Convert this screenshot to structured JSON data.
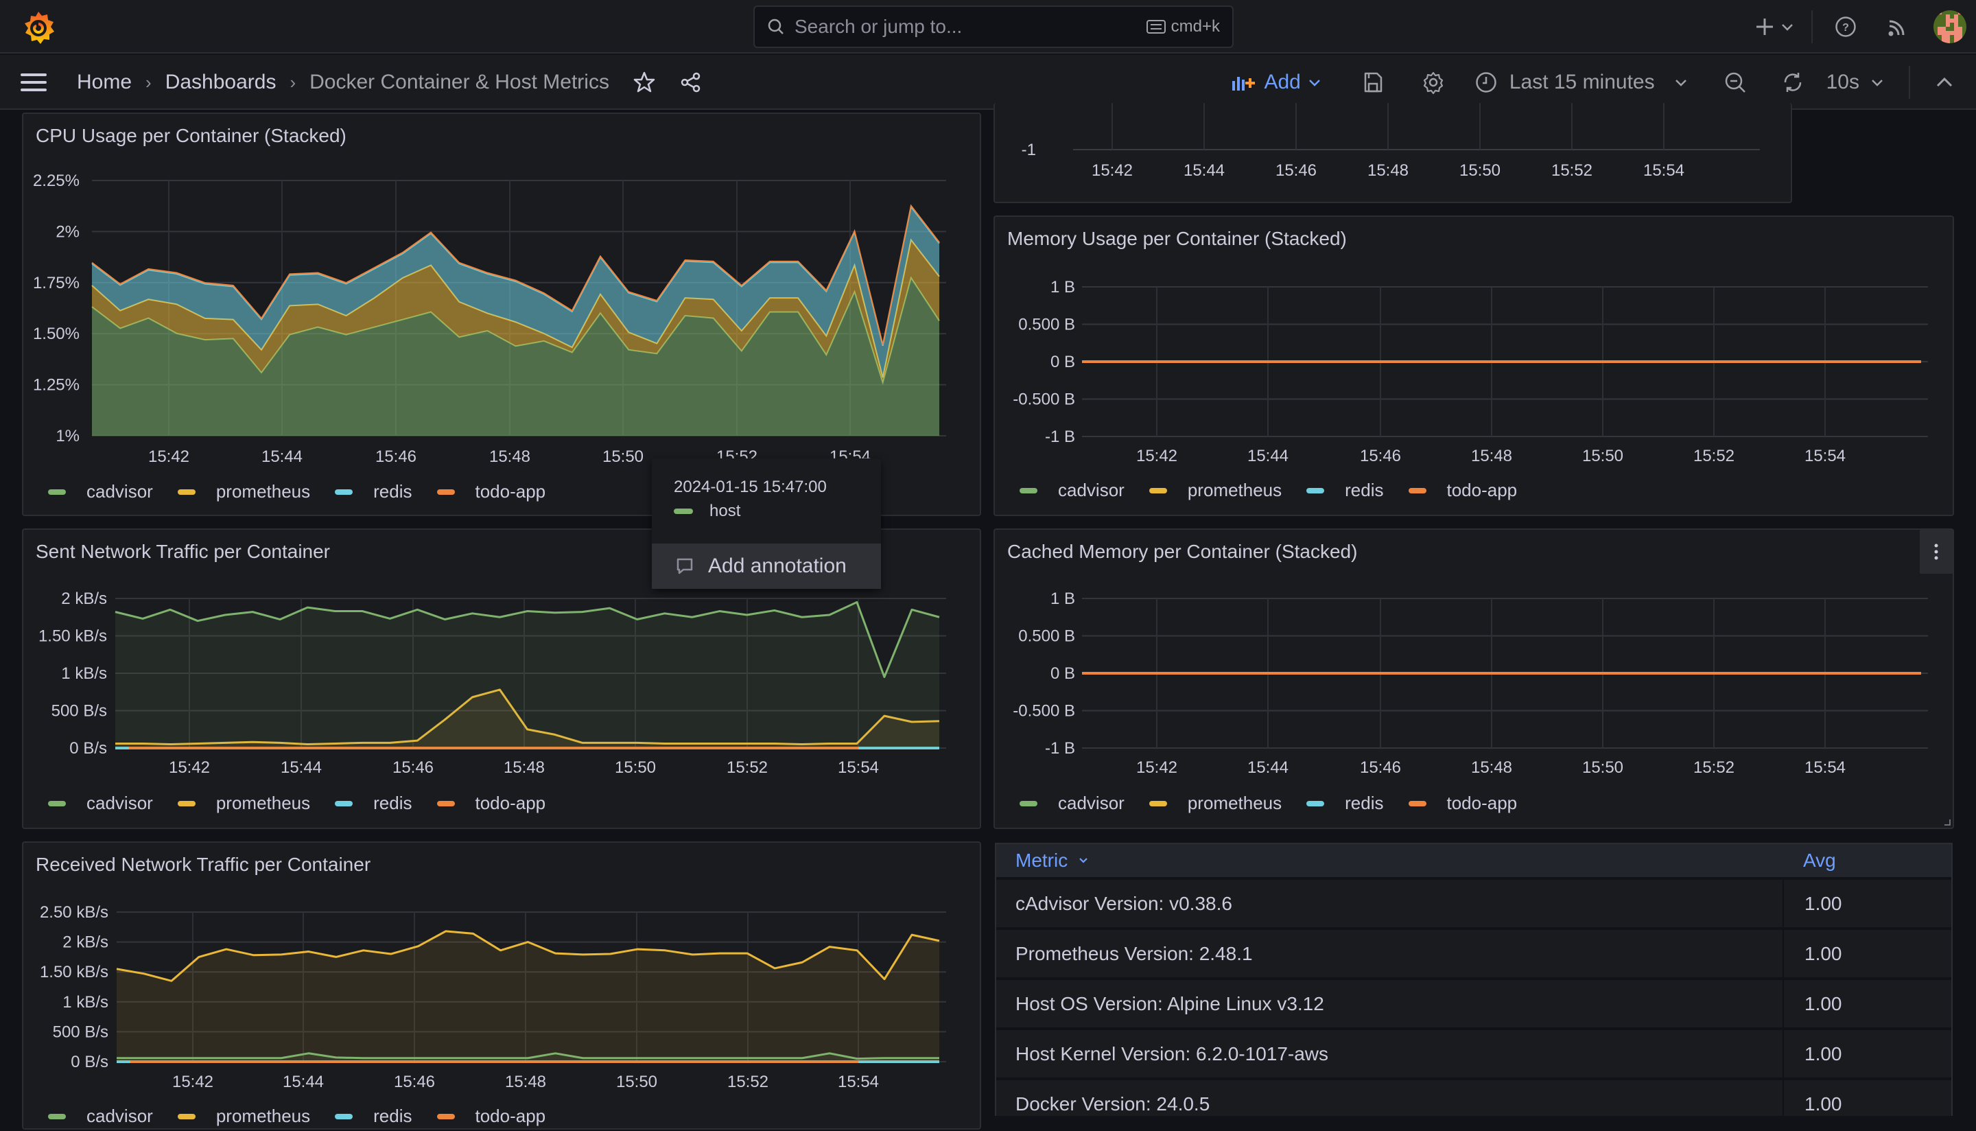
{
  "topbar": {
    "search_placeholder": "Search or jump to...",
    "shortcut": "cmd+k",
    "icons": [
      "grafana-logo",
      "search-icon",
      "keyboard-icon",
      "plus-icon",
      "chevron-down-icon",
      "help-icon",
      "news-icon",
      "avatar"
    ]
  },
  "navbar": {
    "breadcrumbs": [
      "Home",
      "Dashboards",
      "Docker Container & Host Metrics"
    ],
    "add_label": "Add",
    "time_range": "Last 15 minutes",
    "refresh_interval": "10s",
    "accent": "#6e9fff"
  },
  "series_colors": {
    "cadvisor": "#7eb26d",
    "prometheus": "#eab839",
    "redis": "#6ed0e0",
    "todo-app": "#ef843c",
    "host": "#7eb26d"
  },
  "legend": [
    "cadvisor",
    "prometheus",
    "redis",
    "todo-app"
  ],
  "tooltip": {
    "timestamp": "2024-01-15 15:47:00",
    "series": "host",
    "action": "Add annotation"
  },
  "table": {
    "headers": [
      "Metric",
      "Avg"
    ],
    "rows": [
      [
        "cAdvisor Version: v0.38.6",
        "1.00"
      ],
      [
        "Prometheus Version: 2.48.1",
        "1.00"
      ],
      [
        "Host OS Version: Alpine Linux v3.12",
        "1.00"
      ],
      [
        "Host Kernel Version: 6.2.0-1017-aws",
        "1.00"
      ],
      [
        "Docker Version: 24.0.5",
        "1.00"
      ]
    ]
  },
  "chart_data": [
    {
      "id": "cpu",
      "type": "area",
      "stacked": true,
      "title": "CPU Usage per Container (Stacked)",
      "x_ticks": [
        "15:42",
        "15:44",
        "15:46",
        "15:48",
        "15:50",
        "15:52",
        "15:54"
      ],
      "x_range_min": [
        0,
        15.25
      ],
      "x_tick_positions_min": [
        1.35,
        3.35,
        5.35,
        7.35,
        9.35,
        11.35,
        13.35
      ],
      "y_ticks": [
        "1%",
        "1.25%",
        "1.50%",
        "1.75%",
        "2%",
        "2.25%"
      ],
      "ylim": [
        1,
        2.25
      ],
      "y_unit": "%",
      "legend": "bottom-left",
      "series": [
        {
          "name": "cadvisor",
          "values": [
            1.631,
            1.526,
            1.576,
            1.501,
            1.47,
            1.476,
            1.309,
            1.495,
            1.532,
            1.495,
            1.532,
            1.569,
            1.606,
            1.483,
            1.514,
            1.439,
            1.464,
            1.408,
            1.6,
            1.421,
            1.402,
            1.588,
            1.576,
            1.415,
            1.606,
            1.606,
            1.396,
            1.705,
            1.26,
            1.773,
            1.563
          ]
        },
        {
          "name": "prometheus",
          "values": [
            0.105,
            0.087,
            0.092,
            0.143,
            0.105,
            0.093,
            0.112,
            0.142,
            0.112,
            0.093,
            0.143,
            0.204,
            0.229,
            0.173,
            0.086,
            0.118,
            0.037,
            0.025,
            0.093,
            0.086,
            0.05,
            0.087,
            0.092,
            0.099,
            0.069,
            0.069,
            0.093,
            0.13,
            0.025,
            0.186,
            0.217
          ]
        },
        {
          "name": "redis",
          "values": [
            0.107,
            0.125,
            0.144,
            0.149,
            0.169,
            0.162,
            0.149,
            0.15,
            0.149,
            0.156,
            0.143,
            0.119,
            0.156,
            0.187,
            0.193,
            0.199,
            0.193,
            0.175,
            0.181,
            0.193,
            0.205,
            0.18,
            0.181,
            0.217,
            0.174,
            0.174,
            0.218,
            0.162,
            0.156,
            0.162,
            0.162
          ]
        },
        {
          "name": "todo-app",
          "values": [
            0.005,
            0.005,
            0.005,
            0.005,
            0.005,
            0.005,
            0.005,
            0.005,
            0.005,
            0.005,
            0.005,
            0.005,
            0.005,
            0.005,
            0.005,
            0.005,
            0.005,
            0.005,
            0.005,
            0.005,
            0.005,
            0.005,
            0.005,
            0.005,
            0.005,
            0.005,
            0.005,
            0.005,
            0.005,
            0.005,
            0.005
          ]
        }
      ]
    },
    {
      "id": "partial",
      "type": "line",
      "title": "",
      "x_ticks": [
        "15:42",
        "15:44",
        "15:46",
        "15:48",
        "15:50",
        "15:52",
        "15:54"
      ],
      "y_ticks": [
        "-1"
      ],
      "ylim": [
        -1,
        1
      ],
      "series": []
    },
    {
      "id": "mem",
      "type": "line",
      "stacked": true,
      "title": "Memory Usage per Container (Stacked)",
      "x_ticks": [
        "15:42",
        "15:44",
        "15:46",
        "15:48",
        "15:50",
        "15:52",
        "15:54"
      ],
      "y_ticks": [
        "-1 B",
        "-0.500 B",
        "0 B",
        "0.500 B",
        "1 B"
      ],
      "ylim": [
        -1,
        1
      ],
      "legend": "bottom-left",
      "series": [
        {
          "name": "cadvisor",
          "values": [
            0,
            0
          ]
        },
        {
          "name": "prometheus",
          "values": [
            0,
            0
          ]
        },
        {
          "name": "redis",
          "values": [
            0,
            0
          ]
        },
        {
          "name": "todo-app",
          "values": [
            0,
            0
          ]
        }
      ]
    },
    {
      "id": "sent",
      "type": "line",
      "title": "Sent Network Traffic per Container",
      "x_ticks": [
        "15:42",
        "15:44",
        "15:46",
        "15:48",
        "15:50",
        "15:52",
        "15:54"
      ],
      "y_ticks": [
        "0 B/s",
        "500 B/s",
        "1 kB/s",
        "1.50 kB/s",
        "2 kB/s"
      ],
      "ylim": [
        0,
        2000
      ],
      "y_unit": "B/s",
      "legend": "bottom-left",
      "series": [
        {
          "name": "cadvisor",
          "values": [
            1820,
            1730,
            1850,
            1700,
            1780,
            1820,
            1720,
            1880,
            1830,
            1830,
            1730,
            1850,
            1720,
            1800,
            1750,
            1830,
            1810,
            1820,
            1870,
            1720,
            1800,
            1750,
            1830,
            1780,
            1840,
            1750,
            1780,
            1950,
            950,
            1850,
            1750
          ]
        },
        {
          "name": "prometheus",
          "values": [
            60,
            60,
            50,
            60,
            70,
            80,
            70,
            50,
            60,
            70,
            70,
            100,
            380,
            680,
            780,
            250,
            180,
            70,
            70,
            70,
            60,
            60,
            60,
            60,
            60,
            50,
            60,
            60,
            430,
            350,
            360
          ]
        },
        {
          "name": "redis",
          "values": [
            0,
            0,
            0,
            0,
            0,
            0,
            0,
            0,
            0,
            0,
            0,
            0,
            0,
            0,
            0,
            0,
            0,
            0,
            0,
            0,
            0,
            0,
            0,
            0,
            0,
            0,
            0,
            0,
            0,
            0,
            0
          ]
        },
        {
          "name": "todo-app",
          "values": [
            0,
            0,
            0,
            0,
            0,
            0,
            0,
            0,
            0,
            0,
            0,
            0,
            0,
            0,
            0,
            0,
            0,
            0,
            0,
            0,
            0,
            0,
            0,
            0,
            0,
            0,
            0,
            0,
            0,
            0,
            0
          ]
        }
      ]
    },
    {
      "id": "cached",
      "type": "line",
      "stacked": true,
      "title": "Cached Memory per Container (Stacked)",
      "x_ticks": [
        "15:42",
        "15:44",
        "15:46",
        "15:48",
        "15:50",
        "15:52",
        "15:54"
      ],
      "y_ticks": [
        "-1 B",
        "-0.500 B",
        "0 B",
        "0.500 B",
        "1 B"
      ],
      "ylim": [
        -1,
        1
      ],
      "legend": "bottom-left",
      "series": [
        {
          "name": "cadvisor",
          "values": [
            0,
            0
          ]
        },
        {
          "name": "prometheus",
          "values": [
            0,
            0
          ]
        },
        {
          "name": "redis",
          "values": [
            0,
            0
          ]
        },
        {
          "name": "todo-app",
          "values": [
            0,
            0
          ]
        }
      ]
    },
    {
      "id": "recv",
      "type": "line",
      "title": "Received Network Traffic per Container",
      "x_ticks": [
        "15:42",
        "15:44",
        "15:46",
        "15:48",
        "15:50",
        "15:52",
        "15:54"
      ],
      "y_ticks": [
        "0 B/s",
        "500 B/s",
        "1 kB/s",
        "1.50 kB/s",
        "2 kB/s",
        "2.50 kB/s"
      ],
      "ylim": [
        0,
        2500
      ],
      "y_unit": "B/s",
      "legend": "bottom-left",
      "series": [
        {
          "name": "cadvisor",
          "values": [
            60,
            60,
            60,
            60,
            60,
            60,
            60,
            140,
            70,
            60,
            60,
            60,
            60,
            60,
            60,
            60,
            140,
            60,
            60,
            60,
            60,
            60,
            60,
            60,
            60,
            60,
            140,
            50,
            60,
            60,
            60
          ]
        },
        {
          "name": "prometheus",
          "values": [
            1550,
            1470,
            1350,
            1750,
            1880,
            1780,
            1790,
            1840,
            1750,
            1860,
            1800,
            1930,
            2180,
            2140,
            1860,
            2000,
            1810,
            1790,
            1800,
            1880,
            1860,
            1790,
            1810,
            1810,
            1560,
            1660,
            1920,
            1860,
            1380,
            2120,
            2020
          ]
        },
        {
          "name": "redis",
          "values": [
            0,
            0,
            0,
            0,
            0,
            0,
            0,
            0,
            0,
            0,
            0,
            0,
            0,
            0,
            0,
            0,
            0,
            0,
            0,
            0,
            0,
            0,
            0,
            0,
            0,
            0,
            0,
            0,
            0,
            0,
            0
          ]
        },
        {
          "name": "todo-app",
          "values": [
            0,
            0,
            0,
            0,
            0,
            0,
            0,
            0,
            0,
            0,
            0,
            0,
            0,
            0,
            0,
            0,
            0,
            0,
            0,
            0,
            0,
            0,
            0,
            0,
            0,
            0,
            0,
            0,
            0,
            0,
            0
          ]
        }
      ]
    }
  ]
}
